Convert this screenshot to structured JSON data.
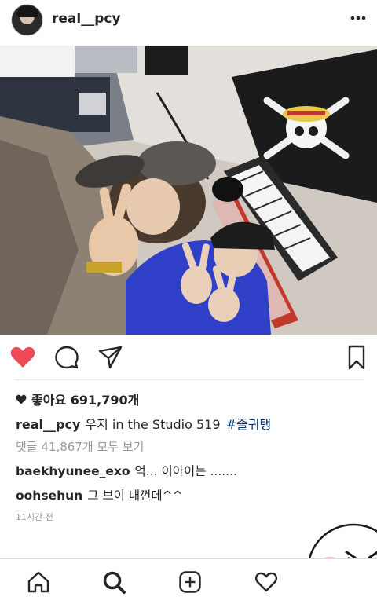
{
  "post": {
    "username": "real__pcy",
    "likes": {
      "text": "좋아요 691,790개"
    },
    "caption": {
      "username": "real__pcy",
      "text": "우지 in the Studio 519",
      "hashtag": "#졸귀탱"
    },
    "view_comments": "댓글 41,867개 모두 보기",
    "comments": [
      {
        "username": "baekhyunee_exo",
        "text": "억... 이아이는 ......."
      },
      {
        "username": "oohsehun",
        "text": "그 브이 내껀데^^"
      }
    ],
    "timestamp": "11시간 전"
  },
  "icons": {
    "header": [
      "avatar",
      "more-icon"
    ],
    "actions": [
      "heart-icon",
      "comment-icon",
      "share-icon",
      "bookmark-icon"
    ],
    "tabbar": [
      "home-icon",
      "search-icon",
      "add-icon",
      "activity-icon",
      "profile-icon"
    ]
  },
  "colors": {
    "like_red": "#ed4956",
    "hashtag_blue": "#003569",
    "muted_gray": "#999999",
    "text": "#262626"
  }
}
